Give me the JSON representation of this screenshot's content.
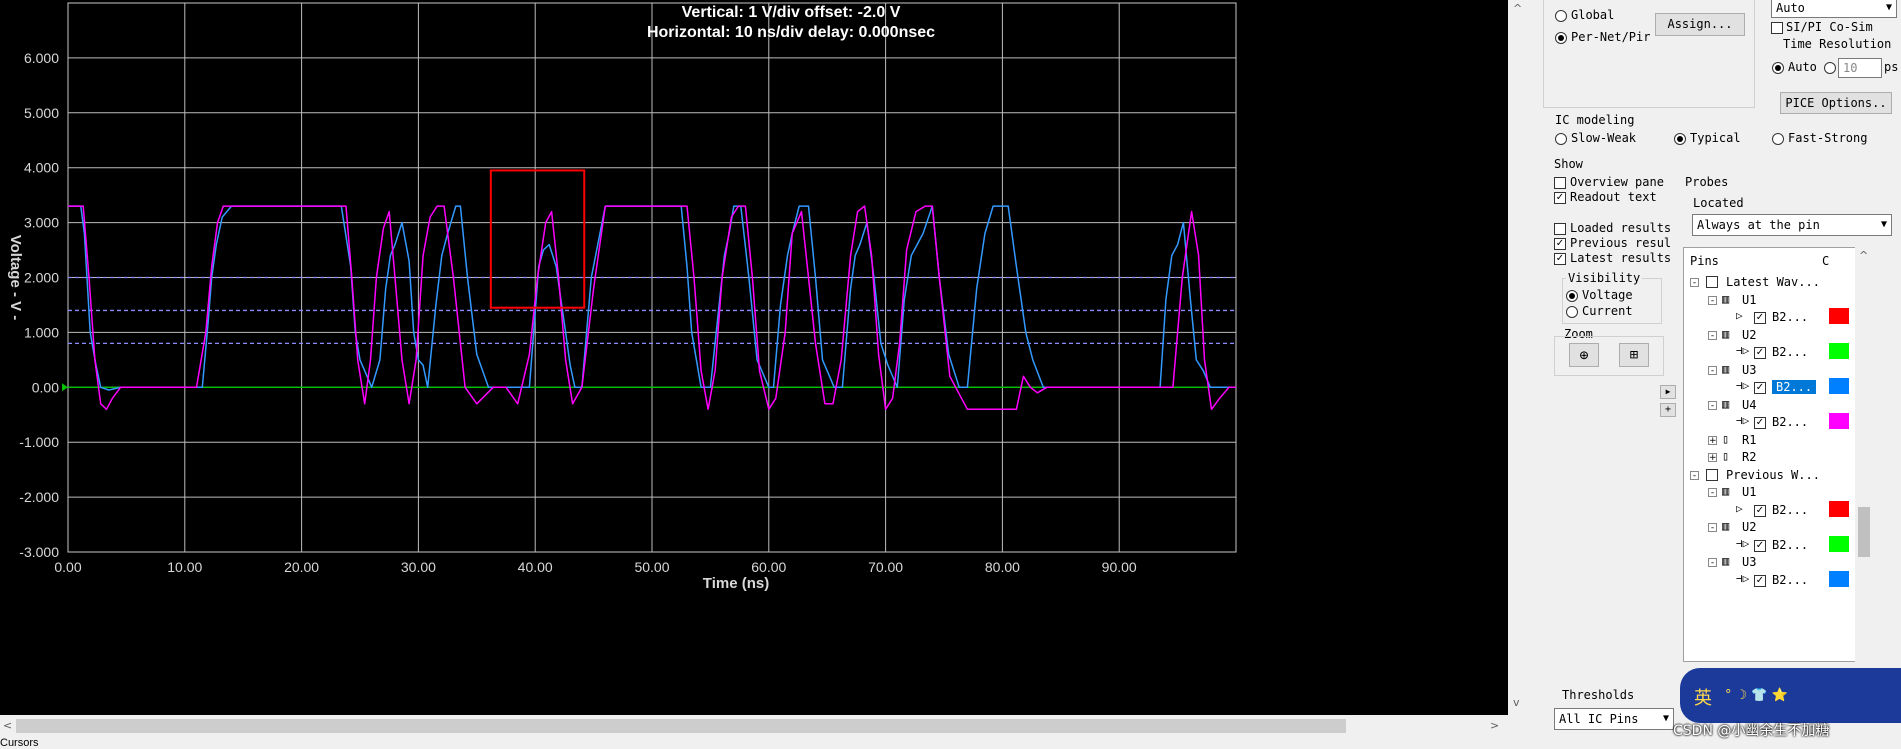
{
  "chart_data": {
    "type": "line",
    "title": "Vertical: 1  V/div  offset: -2.0 V",
    "subtitle": "Horizontal: 10 ns/div  delay: 0.000nsec",
    "xlabel": "Time  (ns)",
    "ylabel": "Voltage  - V -",
    "xlim": [
      0,
      100
    ],
    "ylim": [
      -3,
      7
    ],
    "x_ticks": [
      "0.00",
      "10.00",
      "20.00",
      "30.00",
      "40.00",
      "50.00",
      "60.00",
      "70.00",
      "80.00",
      "90.00"
    ],
    "y_ticks": [
      "6.000",
      "5.000",
      "4.000",
      "3.000",
      "2.000",
      "1.000",
      "0.00",
      "-1.000",
      "-2.000",
      "-3.000"
    ],
    "grid": true,
    "threshold_lines": [
      2.0,
      1.4,
      0.8
    ],
    "ground_line": 0,
    "highlight_box": {
      "x": [
        36.2,
        44.2
      ],
      "y": [
        1.45,
        3.95
      ],
      "color": "#ff0000"
    },
    "series": [
      {
        "color": "#3399ff",
        "x": [
          0,
          1.1,
          1.4,
          1.9,
          2.4,
          2.8,
          3.5,
          4.5,
          5.5,
          11.5,
          12.0,
          12.3,
          12.7,
          13.2,
          14,
          15,
          23.4,
          24.2,
          24.6,
          25.0,
          25.4,
          26.0,
          26.7,
          27.2,
          27.6,
          28,
          28.6,
          29.2,
          29.6,
          30,
          30.4,
          30.8,
          31.5,
          32,
          32.5,
          33.2,
          33.6,
          34.2,
          35,
          36,
          39.5,
          40.3,
          40.7,
          41.2,
          41.8,
          42.6,
          43.0,
          43.4,
          44,
          44.8,
          46,
          52.5,
          53.0,
          53.4,
          53.8,
          54.2,
          55,
          55.8,
          56.2,
          56.6,
          57,
          57.6,
          58.3,
          59,
          59.4,
          60,
          60.4,
          61,
          61.6,
          62,
          62.6,
          63.4,
          64,
          64.6,
          65,
          65.6,
          66.3,
          67,
          67.4,
          67.8,
          68.4,
          69,
          69.6,
          70.2,
          71,
          71.6,
          72.2,
          73.2,
          74,
          74.6,
          75.4,
          76.3,
          77,
          77.8,
          78.5,
          79.2,
          80,
          80.5,
          81.2,
          82,
          82.6,
          83.5,
          84.5,
          93.5,
          94.0,
          94.5,
          95.0,
          95.5,
          96.1,
          96.6,
          97.2,
          97.8,
          98.5,
          99.2,
          100
        ],
        "values": [
          3.3,
          3.3,
          2.8,
          1.0,
          0.4,
          0.0,
          -0.05,
          0.0,
          0.0,
          0.0,
          1.2,
          2.0,
          2.6,
          3.1,
          3.3,
          3.3,
          3.3,
          2.2,
          1.0,
          0.5,
          0.3,
          0.0,
          0.5,
          1.8,
          2.4,
          2.6,
          3.0,
          2.3,
          1.0,
          0.5,
          0.4,
          0.0,
          1.5,
          2.4,
          2.8,
          3.3,
          3.3,
          2.0,
          0.6,
          0.0,
          0.0,
          2.2,
          2.5,
          2.6,
          2.2,
          1.0,
          0.4,
          0.0,
          0.0,
          2.0,
          3.3,
          3.3,
          2.2,
          1.0,
          0.5,
          0.0,
          0.0,
          1.6,
          2.4,
          2.8,
          3.3,
          3.3,
          2.0,
          0.5,
          0.3,
          0.0,
          0.0,
          1.5,
          2.4,
          2.8,
          3.3,
          3.3,
          2.0,
          0.5,
          0.3,
          0.0,
          0.0,
          1.8,
          2.4,
          2.6,
          3.0,
          2.0,
          0.8,
          0.4,
          0.0,
          1.6,
          2.4,
          2.8,
          3.3,
          2.0,
          0.6,
          0.0,
          0.0,
          1.8,
          2.8,
          3.3,
          3.3,
          3.3,
          2.2,
          1.0,
          0.5,
          0.0,
          0.0,
          0.0,
          1.6,
          2.4,
          2.6,
          3.0,
          1.6,
          0.5,
          0.3,
          0.0,
          0.0,
          0.0,
          0.0
        ]
      },
      {
        "color": "#ff00ff",
        "x": [
          0,
          1.3,
          1.8,
          2.3,
          2.8,
          3.3,
          3.8,
          4.5,
          5.5,
          11.0,
          11.8,
          12.3,
          12.8,
          13.3,
          14,
          15,
          23.8,
          24.3,
          24.8,
          25.4,
          25.9,
          26.4,
          27.0,
          27.5,
          28.0,
          28.6,
          29.2,
          29.8,
          30.4,
          31,
          31.6,
          32.2,
          33,
          34,
          35,
          36.4,
          37.5,
          38.5,
          39.5,
          40.2,
          40.9,
          41.4,
          42,
          42.6,
          43.2,
          44,
          45,
          46,
          53,
          53.6,
          54.2,
          54.8,
          55.4,
          56,
          56.8,
          57.4,
          58,
          58.6,
          59.2,
          60,
          60.6,
          61.4,
          62,
          62.8,
          64,
          64.8,
          65.5,
          66.2,
          67,
          67.6,
          68.2,
          68.8,
          69.4,
          70,
          70.6,
          71.2,
          71.8,
          72.6,
          73.4,
          74,
          74.6,
          75.5,
          77,
          81.2,
          81.8,
          82.4,
          83,
          83.8,
          84.8,
          94.6,
          95.4,
          96.2,
          96.8,
          97.3,
          97.9,
          98.6,
          99.4,
          100
        ],
        "values": [
          3.3,
          3.3,
          2.0,
          0.5,
          -0.3,
          -0.4,
          -0.2,
          0.0,
          0.0,
          0.0,
          1.0,
          2.2,
          3.0,
          3.3,
          3.3,
          3.3,
          3.3,
          2.0,
          0.5,
          -0.3,
          0.5,
          2.0,
          2.9,
          3.2,
          2.0,
          0.5,
          -0.3,
          0.5,
          2.4,
          3.1,
          3.3,
          3.3,
          2.0,
          0.0,
          -0.3,
          0.0,
          0.0,
          -0.3,
          0.6,
          2.0,
          3.0,
          3.2,
          2.0,
          0.5,
          -0.3,
          0.0,
          1.8,
          3.3,
          3.3,
          2.0,
          0.3,
          -0.4,
          0.3,
          2.0,
          3.1,
          3.3,
          3.3,
          2.0,
          0.3,
          -0.4,
          -0.2,
          1.0,
          2.8,
          3.2,
          0.8,
          -0.3,
          -0.3,
          0.5,
          2.4,
          3.2,
          3.3,
          2.4,
          0.6,
          -0.4,
          -0.2,
          0.8,
          2.5,
          3.2,
          3.3,
          3.3,
          2.0,
          0.2,
          -0.4,
          -0.4,
          0.2,
          0.0,
          -0.1,
          0.0,
          0.0,
          0.0,
          2.0,
          3.2,
          2.4,
          0.5,
          -0.4,
          -0.2,
          0.0,
          0.0
        ]
      }
    ]
  },
  "scroll": {
    "left": "<",
    "right": ">",
    "down": "v",
    "up": "^"
  },
  "bottom_label": "Cursors",
  "panel": {
    "radio_global": "Global",
    "radio_pernet": "Per-Net/Pir",
    "assign_btn": "Assign...",
    "auto_select": "Auto",
    "sipi": "SI/PI Co-Sim",
    "time_res": "Time Resolution",
    "auto": "Auto",
    "time_value": "10",
    "ps": "ps",
    "spice_btn": "PICE Options..",
    "ic_modeling": "IC modeling",
    "slow": "Slow-Weak",
    "typical": "Typical",
    "fast": "Fast-Strong",
    "show": "Show",
    "overview": "Overview pane",
    "probes": "Probes",
    "readout": "Readout text",
    "located": "Located",
    "located_value": "Always at the pin",
    "loaded": "Loaded results",
    "previous": "Previous resul",
    "latest": "Latest results",
    "visibility": "Visibility",
    "voltage": "Voltage",
    "current": "Current",
    "zoom": "Zoom",
    "pins_header": "Pins",
    "c_header": "C",
    "thresholds": "Thresholds",
    "threshold_value": "All IC Pins",
    "tree": [
      {
        "level": 0,
        "label": "Latest Wav...",
        "exp": "-",
        "chk": true
      },
      {
        "level": 1,
        "label": "U1",
        "exp": "-",
        "chip": true
      },
      {
        "level": 2,
        "label": "B2...",
        "pin": "drv",
        "checked": true,
        "color": "#ff0000"
      },
      {
        "level": 1,
        "label": "U2",
        "exp": "-",
        "chip": true
      },
      {
        "level": 2,
        "label": "B2...",
        "pin": "rcv",
        "checked": true,
        "color": "#00ff00"
      },
      {
        "level": 1,
        "label": "U3",
        "exp": "-",
        "chip": true
      },
      {
        "level": 2,
        "label": "B2...",
        "pin": "rcv",
        "checked": true,
        "color": "#0080ff",
        "selected": true
      },
      {
        "level": 1,
        "label": "U4",
        "exp": "-",
        "chip": true
      },
      {
        "level": 2,
        "label": "B2...",
        "pin": "rcv",
        "checked": true,
        "color": "#ff00ff"
      },
      {
        "level": 1,
        "label": "R1",
        "exp": "+",
        "res": true
      },
      {
        "level": 1,
        "label": "R2",
        "exp": "+",
        "res": true
      },
      {
        "level": 0,
        "label": "Previous W...",
        "exp": "-",
        "chk": true
      },
      {
        "level": 1,
        "label": "U1",
        "exp": "-",
        "chip": true
      },
      {
        "level": 2,
        "label": "B2...",
        "pin": "drv",
        "checked": true,
        "color": "#ff0000"
      },
      {
        "level": 1,
        "label": "U2",
        "exp": "-",
        "chip": true
      },
      {
        "level": 2,
        "label": "B2...",
        "pin": "rcv",
        "checked": true,
        "color": "#00ff00"
      },
      {
        "level": 1,
        "label": "U3",
        "exp": "-",
        "chip": true
      },
      {
        "level": 2,
        "label": "B2...",
        "pin": "rcv",
        "checked": true,
        "color": "#0080ff"
      }
    ]
  },
  "overlay": {
    "watermark": "CSDN @小幽余生不加糖",
    "ime_char": "英",
    "ime_icons": "°   ☽   👕   ⭐"
  }
}
